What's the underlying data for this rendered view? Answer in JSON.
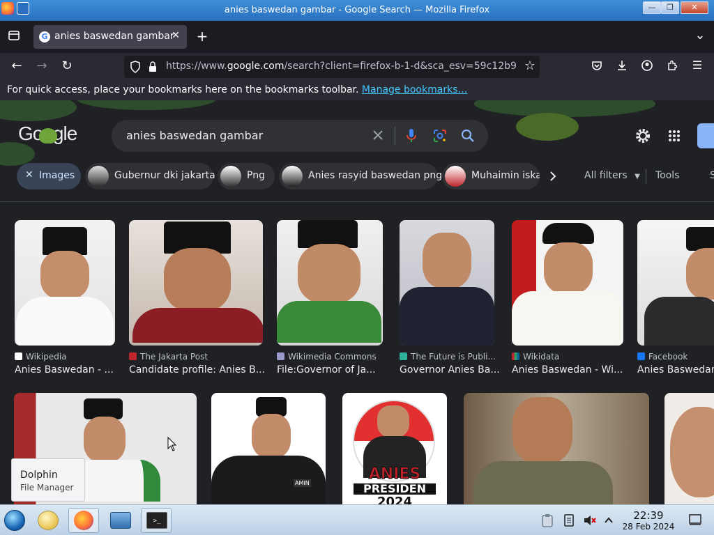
{
  "window": {
    "title": "anies baswedan gambar - Google Search — Mozilla Firefox",
    "min": "—",
    "max": "❐",
    "close": "✕"
  },
  "tabs": [
    {
      "label": "anies baswedan gambar",
      "favicon": "G",
      "close": "✕"
    }
  ],
  "toolbar": {
    "new_tab": "+",
    "list_tabs": "⌄",
    "back": "←",
    "forward": "→",
    "reload": "↻",
    "star": "☆",
    "menu": "☰"
  },
  "urlbar": {
    "prefix": "https://www.",
    "domain": "google.com",
    "rest": "/search?client=firefox-b-1-d&sca_esv=59c12b9"
  },
  "bookmarks": {
    "text": "For quick access, place your bookmarks here on the bookmarks toolbar.",
    "link": "Manage bookmarks…"
  },
  "google": {
    "logo": "Google",
    "query": "anies baswedan gambar",
    "filters": [
      {
        "label": "Images",
        "active": true
      },
      {
        "label": "Gubernur dki jakarta"
      },
      {
        "label": "Png"
      },
      {
        "label": "Anies rasyid baswedan png"
      },
      {
        "label": "Muhaimin iskan"
      }
    ],
    "all_filters": "All filters",
    "tools": "Tools",
    "row1": [
      {
        "source": "Wikipedia",
        "title": "Anies Baswedan - ..."
      },
      {
        "source": "The Jakarta Post",
        "title": "Candidate profile: Anies B..."
      },
      {
        "source": "Wikimedia Commons",
        "title": "File:Governor of Ja..."
      },
      {
        "source": "The Future is Publi...",
        "title": "Governor Anies Ba..."
      },
      {
        "source": "Wikidata",
        "title": "Anies Baswedan - Wi..."
      },
      {
        "source": "Facebook",
        "title": "Anies Baswedan"
      }
    ],
    "poster_text": [
      "ANIES",
      "PRESIDEN",
      "2024"
    ],
    "badge": "AMIN"
  },
  "tooltip": {
    "title": "Dolphin",
    "subtitle": "File Manager"
  },
  "taskbar": {
    "time": "22:39",
    "date": "28 Feb 2024"
  }
}
